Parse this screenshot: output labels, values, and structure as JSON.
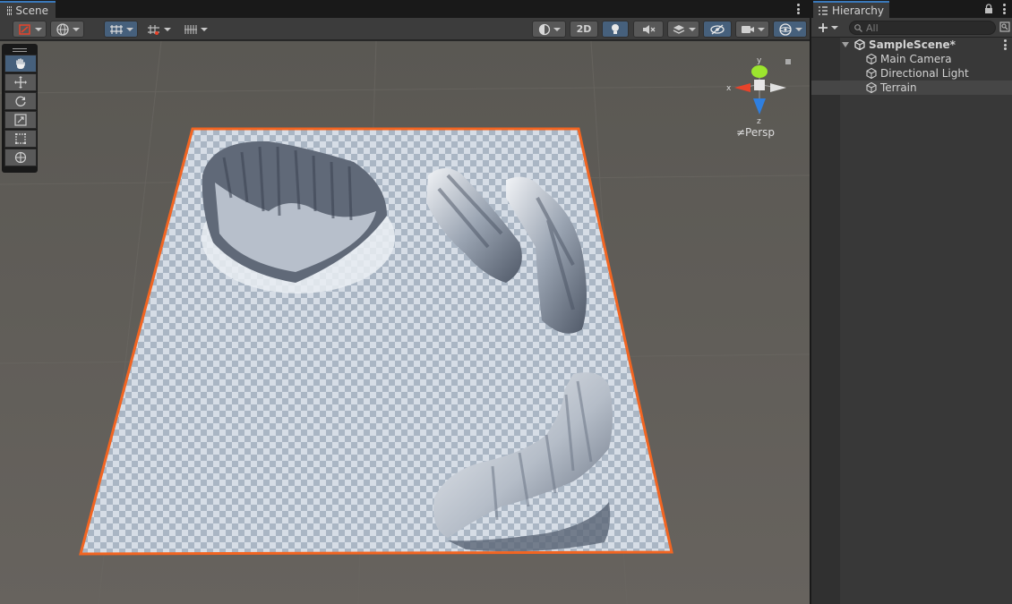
{
  "scene_panel": {
    "tab_title": "Scene",
    "toolbar": {
      "two_d_label": "2D"
    },
    "persp_label": "≠Persp",
    "gizmo": {
      "axis_y": "y",
      "axis_x": "x",
      "axis_z": "z"
    },
    "colors": {
      "selection_outline": "#f26522",
      "active_tool": "#46607c",
      "gizmo_y": "#9ce52e",
      "gizmo_x": "#e8432a",
      "gizmo_z": "#2f7fe0"
    }
  },
  "hierarchy": {
    "tab_title": "Hierarchy",
    "search_placeholder": "All",
    "scene_name": "SampleScene*",
    "items": [
      {
        "label": "Main Camera"
      },
      {
        "label": "Directional Light"
      },
      {
        "label": "Terrain"
      }
    ]
  }
}
